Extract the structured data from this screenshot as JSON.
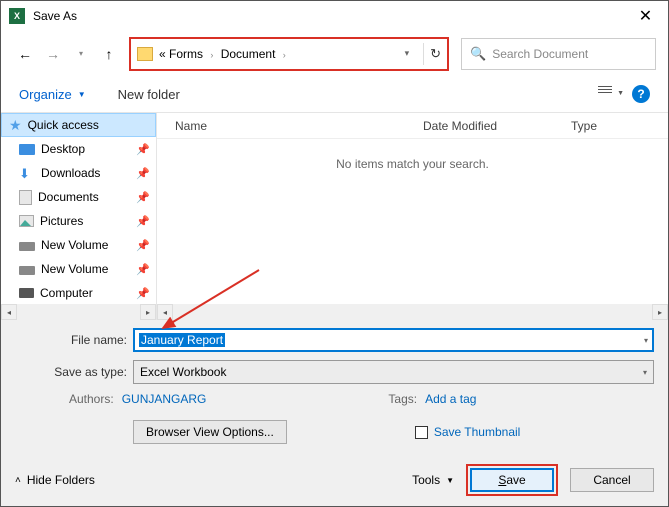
{
  "titlebar": {
    "title": "Save As"
  },
  "nav": {
    "breadcrumb_prefix": "«",
    "crumb1": "Forms",
    "crumb2": "Document"
  },
  "search": {
    "placeholder": "Search Document"
  },
  "toolbar": {
    "organize": "Organize",
    "new_folder": "New folder"
  },
  "sidebar": {
    "items": [
      {
        "label": "Quick access"
      },
      {
        "label": "Desktop"
      },
      {
        "label": "Downloads"
      },
      {
        "label": "Documents"
      },
      {
        "label": "Pictures"
      },
      {
        "label": "New Volume"
      },
      {
        "label": "New Volume"
      },
      {
        "label": "Computer"
      }
    ]
  },
  "columns": {
    "name": "Name",
    "date": "Date Modified",
    "type": "Type"
  },
  "empty_msg": "No items match your search.",
  "fields": {
    "filename_label": "File name:",
    "filename_value": "January Report",
    "type_label": "Save as type:",
    "type_value": "Excel Workbook",
    "authors_label": "Authors:",
    "authors_value": "GUNJANGARG",
    "tags_label": "Tags:",
    "tags_value": "Add a tag",
    "browser_view": "Browser View Options...",
    "save_thumb": "Save Thumbnail"
  },
  "footer": {
    "hide_folders": "Hide Folders",
    "tools": "Tools",
    "save": "Save",
    "cancel": "Cancel"
  }
}
